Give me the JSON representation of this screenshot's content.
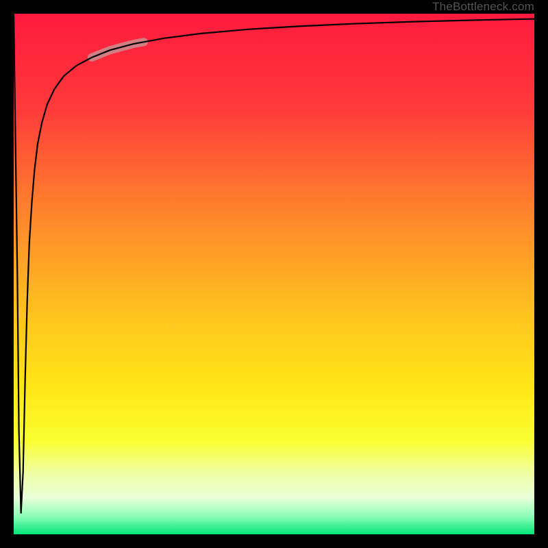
{
  "watermark": "TheBottleneck.com",
  "gradient": {
    "stops": [
      {
        "offset": 0.0,
        "color": "#ff1a3e"
      },
      {
        "offset": 0.18,
        "color": "#ff3a3a"
      },
      {
        "offset": 0.4,
        "color": "#ff8a2a"
      },
      {
        "offset": 0.58,
        "color": "#ffc41e"
      },
      {
        "offset": 0.72,
        "color": "#ffe615"
      },
      {
        "offset": 0.82,
        "color": "#faff30"
      },
      {
        "offset": 0.88,
        "color": "#f0ffa0"
      },
      {
        "offset": 0.93,
        "color": "#e8ffd8"
      },
      {
        "offset": 0.965,
        "color": "#8effb8"
      },
      {
        "offset": 1.0,
        "color": "#00e676"
      }
    ]
  },
  "curve": {
    "stroke": "#000000",
    "stroke_width": 2.2,
    "highlight": {
      "stroke": "#c88e8e",
      "stroke_width": 12,
      "opacity": 0.85,
      "t_range": [
        0.215,
        0.32
      ]
    }
  },
  "chart_data": {
    "type": "line",
    "title": "",
    "xlabel": "",
    "ylabel": "",
    "xlim": [
      0,
      100
    ],
    "ylim": [
      0,
      100
    ],
    "series": [
      {
        "name": "curve",
        "x": [
          0.0,
          0.7,
          1.0,
          1.4,
          1.8,
          2.2,
          2.6,
          3.0,
          3.5,
          4.0,
          4.6,
          5.4,
          6.4,
          7.8,
          9.6,
          12.0,
          15.0,
          18.5,
          23.0,
          29.0,
          36.0,
          45.0,
          55.0,
          66.0,
          78.0,
          90.0,
          100.0
        ],
        "y": [
          100.0,
          50.0,
          20.0,
          4.0,
          12.0,
          30.0,
          45.0,
          56.0,
          64.0,
          70.0,
          75.0,
          79.0,
          82.5,
          85.5,
          88.0,
          90.0,
          91.6,
          93.0,
          94.2,
          95.3,
          96.2,
          97.0,
          97.6,
          98.1,
          98.5,
          98.8,
          99.0
        ]
      }
    ],
    "highlight_segment": {
      "x_from": 15.0,
      "x_to": 25.0
    }
  }
}
